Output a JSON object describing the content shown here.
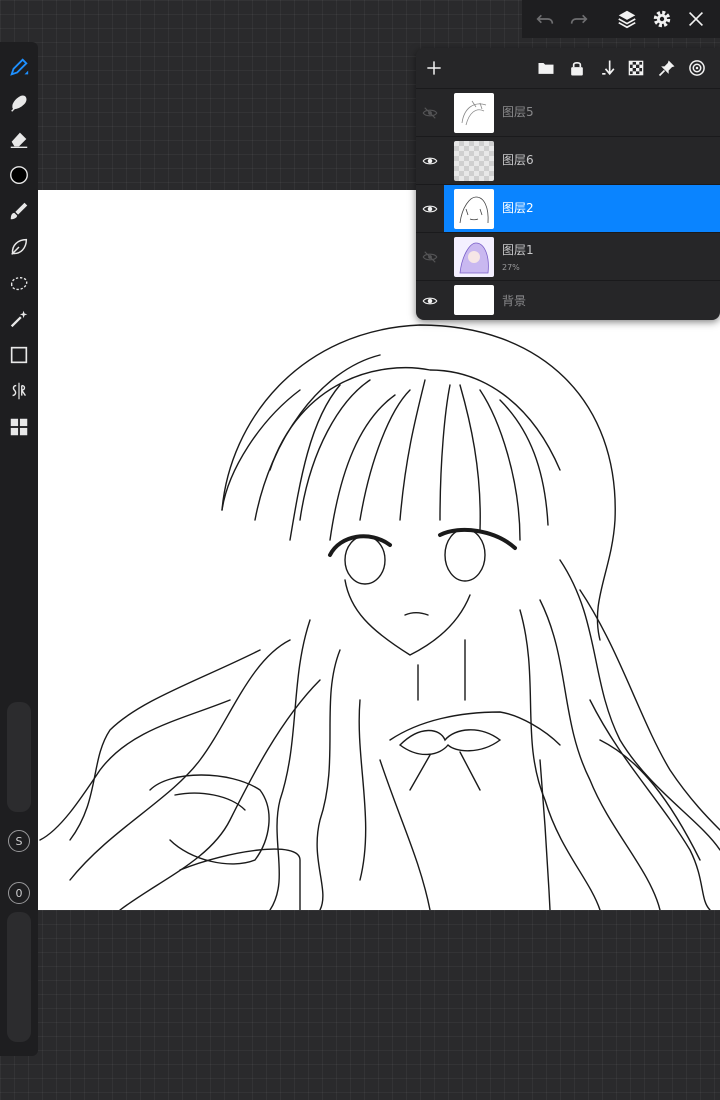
{
  "toolbar": {
    "tools": [
      {
        "name": "brush-tool",
        "icon": "pen-icon",
        "active": true
      },
      {
        "name": "smudge-tool",
        "icon": "smudge-icon"
      },
      {
        "name": "eraser-tool",
        "icon": "eraser-icon"
      },
      {
        "name": "color-tool",
        "icon": "color-circle-icon",
        "color": "#000000"
      },
      {
        "name": "paint-tool",
        "icon": "paintbrush-icon"
      },
      {
        "name": "lasso-fill-tool",
        "icon": "leaf-icon"
      },
      {
        "name": "lasso-tool",
        "icon": "lasso-icon"
      },
      {
        "name": "magic-wand-tool",
        "icon": "magic-wand-icon"
      },
      {
        "name": "rectangle-tool",
        "icon": "square-icon"
      },
      {
        "name": "symmetry-tool",
        "icon": "symmetry-icon"
      },
      {
        "name": "layout-tool",
        "icon": "grid-icon"
      }
    ],
    "size_button": "S",
    "opacity_button": "0"
  },
  "topbar": {
    "icons": [
      "undo-icon",
      "redo-icon",
      "layers-icon",
      "gear-icon",
      "close-icon"
    ]
  },
  "layers_panel": {
    "header_icons": [
      "add-icon",
      "folder-icon",
      "lock-icon",
      "merge-down-icon",
      "checker-icon",
      "pin-icon",
      "target-icon"
    ],
    "layers": [
      {
        "name": "图层5",
        "visible": false,
        "selected": false,
        "thumb": "sketch"
      },
      {
        "name": "图层6",
        "visible": true,
        "selected": false,
        "thumb": "transparent"
      },
      {
        "name": "图层2",
        "visible": true,
        "selected": true,
        "thumb": "lineart"
      },
      {
        "name": "图层1",
        "opacity": "27%",
        "visible": false,
        "selected": false,
        "thumb": "color"
      },
      {
        "name": "背景",
        "visible": true,
        "selected": false,
        "thumb": "white"
      }
    ],
    "accent_color": "#0a84ff"
  },
  "canvas": {
    "background": "#ffffff",
    "subject": "line-art-girl"
  }
}
